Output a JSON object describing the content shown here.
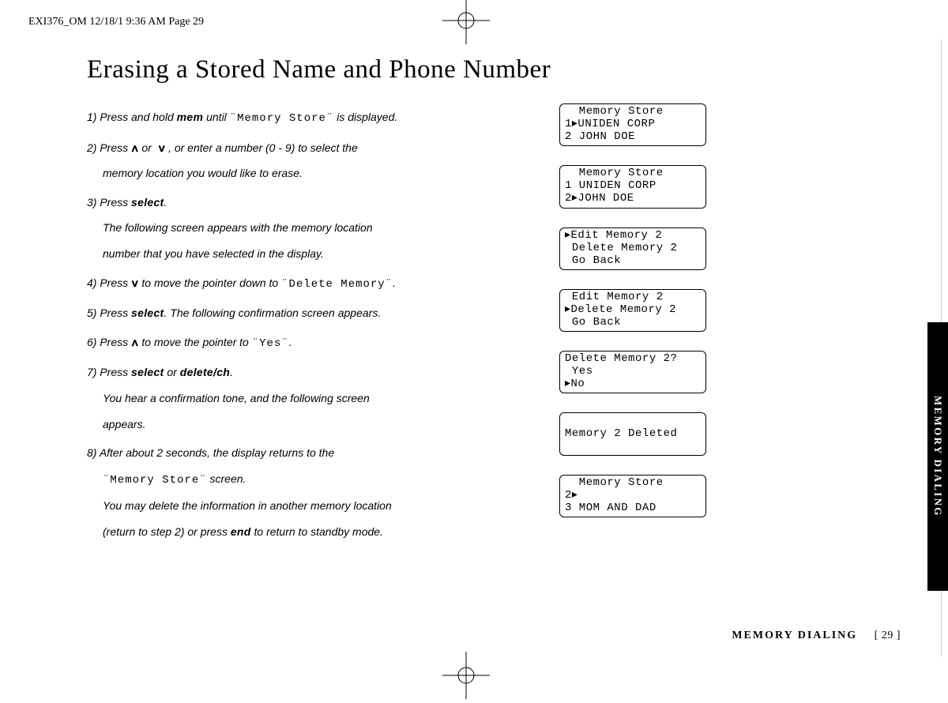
{
  "slug": "EXI376_OM  12/18/1 9:36 AM  Page 29",
  "title": "Erasing a Stored Name and Phone Number",
  "steps": {
    "s1_a": "1) Press and hold ",
    "s1_mem": "mem",
    "s1_b": " until ",
    "s1_lcd": "¨Memory Store¨",
    "s1_c": " is displayed.",
    "s2_a": "2) Press ",
    "s2_up": "∧",
    "s2_b": " or ",
    "s2_dn": "∨",
    "s2_c": " , or enter a number (0 - 9) to select the",
    "s2_sub": "memory location you would like to erase.",
    "s3_a": "3) Press ",
    "s3_select": "select",
    "s3_b": ".",
    "s3_sub1": "The following screen appears with the memory location",
    "s3_sub2": "number that you have selected in the display.",
    "s4_a": "4) Press ",
    "s4_dn": "∨",
    "s4_b": " to move the pointer down to ",
    "s4_lcd": "¨Delete Memory¨",
    "s4_c": ".",
    "s5_a": "5) Press ",
    "s5_select": "select",
    "s5_b": ". The following confirmation screen appears.",
    "s6_a": "6) Press ",
    "s6_up": "∧",
    "s6_b": " to move the pointer to ",
    "s6_lcd": "¨Yes¨",
    "s6_c": ".",
    "s7_a": "7) Press ",
    "s7_select": "select",
    "s7_b": " or ",
    "s7_delete": "delete/ch",
    "s7_c": ".",
    "s7_sub1": "You hear a confirmation tone, and the following screen",
    "s7_sub2": "appears.",
    "s8_a": "8) After about 2 seconds, the display returns to the",
    "s8_sub1a": "",
    "s8_lcd": "¨Memory Store¨",
    "s8_sub1b": " screen.",
    "s8_sub2": "You may delete the information in another memory location",
    "s8_sub3a": "(return to step 2) or press ",
    "s8_end": "end",
    "s8_sub3b": " to return to standby mode."
  },
  "screens": [
    "  Memory Store\n1▸UNIDEN CORP\n2 JOHN DOE",
    "  Memory Store\n1 UNIDEN CORP\n2▸JOHN DOE",
    "▸Edit Memory 2\n Delete Memory 2\n Go Back",
    " Edit Memory 2\n▸Delete Memory 2\n Go Back",
    "Delete Memory 2?\n Yes\n▸No",
    "\nMemory 2 Deleted\n ",
    "  Memory Store\n2▸\n3 MOM AND DAD"
  ],
  "footer_section": "MEMORY DIALING",
  "footer_page": "[ 29 ]",
  "side_tab": "MEMORY DIALING"
}
